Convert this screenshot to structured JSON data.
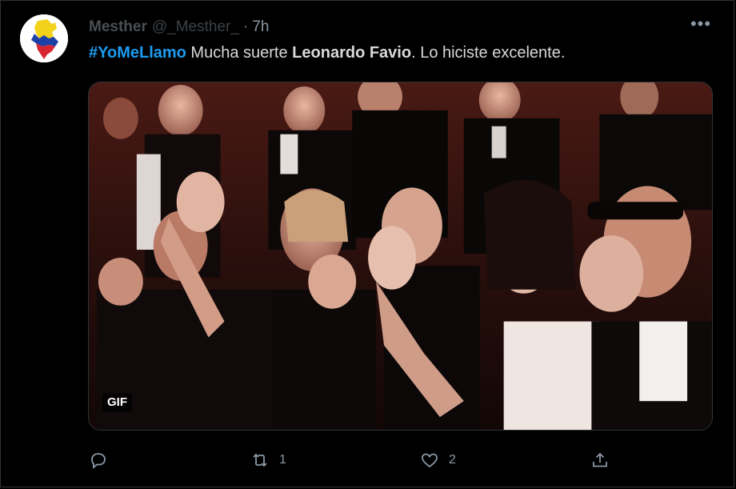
{
  "tweet": {
    "author_name": "Mesther",
    "author_handle": "@_Mesther_",
    "separator": "·",
    "time": "7h",
    "more_label": "•••",
    "text_parts": {
      "hashtag": "#YoMeLlamo",
      "part1": " Mucha suerte ",
      "bold": "Leonardo Favio",
      "part2": ". Lo hiciste excelente."
    },
    "media": {
      "type": "gif",
      "badge": "GIF"
    }
  },
  "actions": {
    "reply": {
      "icon": "reply-icon",
      "count": ""
    },
    "retweet": {
      "icon": "retweet-icon",
      "count": "1"
    },
    "like": {
      "icon": "heart-icon",
      "count": "2"
    },
    "share": {
      "icon": "share-icon",
      "count": ""
    }
  },
  "colors": {
    "background": "#000000",
    "accent": "#1d9bf0",
    "muted": "#8b98a5",
    "text": "#d9d9d9"
  }
}
